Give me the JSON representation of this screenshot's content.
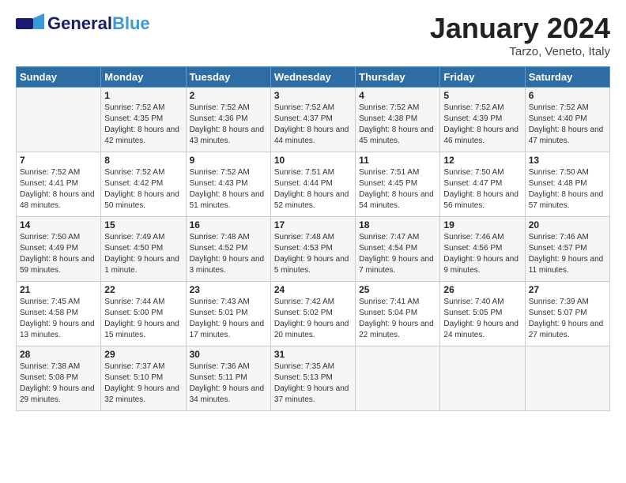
{
  "header": {
    "logo_general": "General",
    "logo_blue": "Blue",
    "month_title": "January 2024",
    "location": "Tarzo, Veneto, Italy"
  },
  "days_of_week": [
    "Sunday",
    "Monday",
    "Tuesday",
    "Wednesday",
    "Thursday",
    "Friday",
    "Saturday"
  ],
  "weeks": [
    [
      {
        "day": "",
        "sunrise": "",
        "sunset": "",
        "daylight": ""
      },
      {
        "day": "1",
        "sunrise": "Sunrise: 7:52 AM",
        "sunset": "Sunset: 4:35 PM",
        "daylight": "Daylight: 8 hours and 42 minutes."
      },
      {
        "day": "2",
        "sunrise": "Sunrise: 7:52 AM",
        "sunset": "Sunset: 4:36 PM",
        "daylight": "Daylight: 8 hours and 43 minutes."
      },
      {
        "day": "3",
        "sunrise": "Sunrise: 7:52 AM",
        "sunset": "Sunset: 4:37 PM",
        "daylight": "Daylight: 8 hours and 44 minutes."
      },
      {
        "day": "4",
        "sunrise": "Sunrise: 7:52 AM",
        "sunset": "Sunset: 4:38 PM",
        "daylight": "Daylight: 8 hours and 45 minutes."
      },
      {
        "day": "5",
        "sunrise": "Sunrise: 7:52 AM",
        "sunset": "Sunset: 4:39 PM",
        "daylight": "Daylight: 8 hours and 46 minutes."
      },
      {
        "day": "6",
        "sunrise": "Sunrise: 7:52 AM",
        "sunset": "Sunset: 4:40 PM",
        "daylight": "Daylight: 8 hours and 47 minutes."
      }
    ],
    [
      {
        "day": "7",
        "sunrise": "Sunrise: 7:52 AM",
        "sunset": "Sunset: 4:41 PM",
        "daylight": "Daylight: 8 hours and 48 minutes."
      },
      {
        "day": "8",
        "sunrise": "Sunrise: 7:52 AM",
        "sunset": "Sunset: 4:42 PM",
        "daylight": "Daylight: 8 hours and 50 minutes."
      },
      {
        "day": "9",
        "sunrise": "Sunrise: 7:52 AM",
        "sunset": "Sunset: 4:43 PM",
        "daylight": "Daylight: 8 hours and 51 minutes."
      },
      {
        "day": "10",
        "sunrise": "Sunrise: 7:51 AM",
        "sunset": "Sunset: 4:44 PM",
        "daylight": "Daylight: 8 hours and 52 minutes."
      },
      {
        "day": "11",
        "sunrise": "Sunrise: 7:51 AM",
        "sunset": "Sunset: 4:45 PM",
        "daylight": "Daylight: 8 hours and 54 minutes."
      },
      {
        "day": "12",
        "sunrise": "Sunrise: 7:50 AM",
        "sunset": "Sunset: 4:47 PM",
        "daylight": "Daylight: 8 hours and 56 minutes."
      },
      {
        "day": "13",
        "sunrise": "Sunrise: 7:50 AM",
        "sunset": "Sunset: 4:48 PM",
        "daylight": "Daylight: 8 hours and 57 minutes."
      }
    ],
    [
      {
        "day": "14",
        "sunrise": "Sunrise: 7:50 AM",
        "sunset": "Sunset: 4:49 PM",
        "daylight": "Daylight: 8 hours and 59 minutes."
      },
      {
        "day": "15",
        "sunrise": "Sunrise: 7:49 AM",
        "sunset": "Sunset: 4:50 PM",
        "daylight": "Daylight: 9 hours and 1 minute."
      },
      {
        "day": "16",
        "sunrise": "Sunrise: 7:48 AM",
        "sunset": "Sunset: 4:52 PM",
        "daylight": "Daylight: 9 hours and 3 minutes."
      },
      {
        "day": "17",
        "sunrise": "Sunrise: 7:48 AM",
        "sunset": "Sunset: 4:53 PM",
        "daylight": "Daylight: 9 hours and 5 minutes."
      },
      {
        "day": "18",
        "sunrise": "Sunrise: 7:47 AM",
        "sunset": "Sunset: 4:54 PM",
        "daylight": "Daylight: 9 hours and 7 minutes."
      },
      {
        "day": "19",
        "sunrise": "Sunrise: 7:46 AM",
        "sunset": "Sunset: 4:56 PM",
        "daylight": "Daylight: 9 hours and 9 minutes."
      },
      {
        "day": "20",
        "sunrise": "Sunrise: 7:46 AM",
        "sunset": "Sunset: 4:57 PM",
        "daylight": "Daylight: 9 hours and 11 minutes."
      }
    ],
    [
      {
        "day": "21",
        "sunrise": "Sunrise: 7:45 AM",
        "sunset": "Sunset: 4:58 PM",
        "daylight": "Daylight: 9 hours and 13 minutes."
      },
      {
        "day": "22",
        "sunrise": "Sunrise: 7:44 AM",
        "sunset": "Sunset: 5:00 PM",
        "daylight": "Daylight: 9 hours and 15 minutes."
      },
      {
        "day": "23",
        "sunrise": "Sunrise: 7:43 AM",
        "sunset": "Sunset: 5:01 PM",
        "daylight": "Daylight: 9 hours and 17 minutes."
      },
      {
        "day": "24",
        "sunrise": "Sunrise: 7:42 AM",
        "sunset": "Sunset: 5:02 PM",
        "daylight": "Daylight: 9 hours and 20 minutes."
      },
      {
        "day": "25",
        "sunrise": "Sunrise: 7:41 AM",
        "sunset": "Sunset: 5:04 PM",
        "daylight": "Daylight: 9 hours and 22 minutes."
      },
      {
        "day": "26",
        "sunrise": "Sunrise: 7:40 AM",
        "sunset": "Sunset: 5:05 PM",
        "daylight": "Daylight: 9 hours and 24 minutes."
      },
      {
        "day": "27",
        "sunrise": "Sunrise: 7:39 AM",
        "sunset": "Sunset: 5:07 PM",
        "daylight": "Daylight: 9 hours and 27 minutes."
      }
    ],
    [
      {
        "day": "28",
        "sunrise": "Sunrise: 7:38 AM",
        "sunset": "Sunset: 5:08 PM",
        "daylight": "Daylight: 9 hours and 29 minutes."
      },
      {
        "day": "29",
        "sunrise": "Sunrise: 7:37 AM",
        "sunset": "Sunset: 5:10 PM",
        "daylight": "Daylight: 9 hours and 32 minutes."
      },
      {
        "day": "30",
        "sunrise": "Sunrise: 7:36 AM",
        "sunset": "Sunset: 5:11 PM",
        "daylight": "Daylight: 9 hours and 34 minutes."
      },
      {
        "day": "31",
        "sunrise": "Sunrise: 7:35 AM",
        "sunset": "Sunset: 5:13 PM",
        "daylight": "Daylight: 9 hours and 37 minutes."
      },
      {
        "day": "",
        "sunrise": "",
        "sunset": "",
        "daylight": ""
      },
      {
        "day": "",
        "sunrise": "",
        "sunset": "",
        "daylight": ""
      },
      {
        "day": "",
        "sunrise": "",
        "sunset": "",
        "daylight": ""
      }
    ]
  ]
}
